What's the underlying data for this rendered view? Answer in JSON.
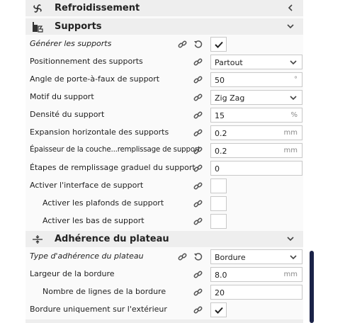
{
  "categories": {
    "cooling": {
      "title": "Refroidissement",
      "icon": "fan-icon",
      "arrow": "chevron-left-icon"
    },
    "support": {
      "title": "Supports",
      "icon": "support-icon",
      "arrow": "chevron-down-icon"
    },
    "adhesion": {
      "title": "Adhérence du plateau",
      "icon": "adhesion-icon",
      "arrow": "chevron-down-icon"
    }
  },
  "rows": {
    "generate": {
      "label": "Générer les supports",
      "checked": true
    },
    "placement": {
      "label": "Positionnement des supports",
      "value": "Partout"
    },
    "angle": {
      "label": "Angle de porte-à-faux de support",
      "value": "50",
      "unit": "°"
    },
    "pattern": {
      "label": "Motif du support",
      "value": "Zig Zag"
    },
    "density": {
      "label": "Densité du support",
      "value": "15",
      "unit": "%"
    },
    "expansion": {
      "label": "Expansion horizontale des supports",
      "value": "0.2",
      "unit": "mm"
    },
    "infill_thickness": {
      "label": "Épaisseur de la couche...remplissage de support",
      "value": "0.2",
      "unit": "mm"
    },
    "gradual_steps": {
      "label": "Étapes de remplissage graduel du support",
      "value": "0"
    },
    "interface": {
      "label": "Activer l'interface de support",
      "checked": false
    },
    "roof": {
      "label": "Activer les plafonds de support",
      "checked": false
    },
    "bottom": {
      "label": "Activer les bas de support",
      "checked": false
    },
    "adhesion_type": {
      "label": "Type d'adhérence du plateau",
      "value": "Bordure"
    },
    "brim_width": {
      "label": "Largeur de la bordure",
      "value": "8.0",
      "unit": "mm"
    },
    "brim_lines": {
      "label": "Nombre de lignes de la bordure",
      "value": "20"
    },
    "brim_outside": {
      "label": "Bordure uniquement sur l'extérieur",
      "checked": true
    }
  },
  "colors": {
    "accent": "#1a2247",
    "category_bg": "#eeeeee",
    "border": "#c9c9c9"
  }
}
